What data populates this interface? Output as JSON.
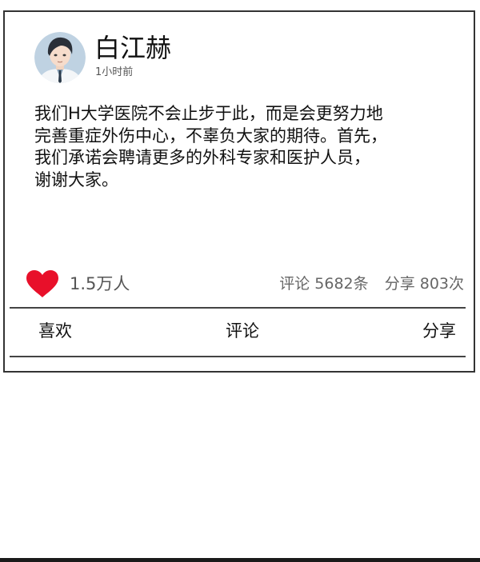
{
  "post": {
    "author": "白江赫",
    "time": "1小时前",
    "body": "我们H大学医院不会止步于此，而是会更努力地\n完善重症外伤中心，不辜负大家的期待。首先，\n我们承诺会聘请更多的外科专家和医护人员，\n谢谢大家。",
    "likes": "1.5万人",
    "comments": "评论 5682条",
    "shares": "分享 803次"
  },
  "actions": {
    "like_label": "喜欢",
    "comment_label": "评论",
    "share_label": "分享"
  },
  "icons": {
    "heart": "heart-icon",
    "avatar": "avatar"
  },
  "colors": {
    "heart": "#e8102a",
    "border": "#333333",
    "muted_text": "#666666"
  }
}
